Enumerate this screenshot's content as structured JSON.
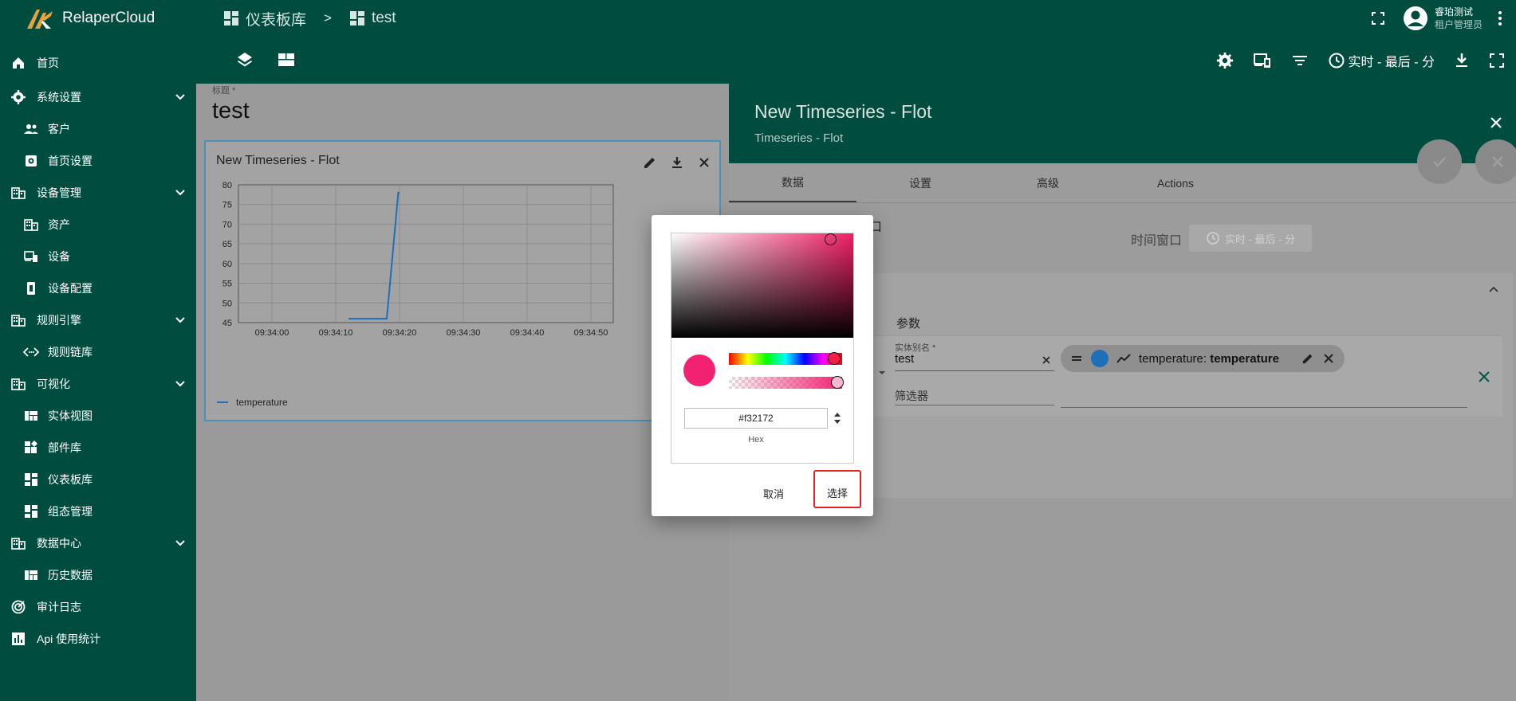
{
  "app": {
    "name": "RelaperCloud"
  },
  "sidebar": {
    "items": [
      {
        "label": "首页",
        "icon": "home-icon"
      },
      {
        "label": "系统设置",
        "icon": "gear-icon",
        "expandable": true
      },
      {
        "label": "客户",
        "icon": "people-icon",
        "sub": true
      },
      {
        "label": "首页设置",
        "icon": "settings-box-icon",
        "sub": true
      },
      {
        "label": "设备管理",
        "icon": "building-icon",
        "expandable": true
      },
      {
        "label": "资产",
        "icon": "building-icon",
        "sub": true
      },
      {
        "label": "设备",
        "icon": "devices-icon",
        "sub": true
      },
      {
        "label": "设备配置",
        "icon": "device-profile-icon",
        "sub": true
      },
      {
        "label": "规则引擎",
        "icon": "building-icon",
        "expandable": true
      },
      {
        "label": "规则链库",
        "icon": "code-icon",
        "sub": true
      },
      {
        "label": "可视化",
        "icon": "building-icon",
        "expandable": true
      },
      {
        "label": "实体视图",
        "icon": "view-quilt-icon",
        "sub": true
      },
      {
        "label": "部件库",
        "icon": "widgets-icon",
        "sub": true
      },
      {
        "label": "仪表板库",
        "icon": "dashboard-icon",
        "sub": true
      },
      {
        "label": "组态管理",
        "icon": "dashboard-icon",
        "sub": true
      },
      {
        "label": "数据中心",
        "icon": "building-icon",
        "expandable": true
      },
      {
        "label": "历史数据",
        "icon": "view-quilt-icon",
        "sub": true
      },
      {
        "label": "审计日志",
        "icon": "track-changes-icon"
      },
      {
        "label": "Api 使用统计",
        "icon": "insert-chart-icon"
      }
    ]
  },
  "header": {
    "breadcrumb": [
      {
        "label": "仪表板库"
      },
      {
        "label": "test"
      }
    ],
    "separator": ">",
    "user_name": "睿珀测试",
    "user_role": "租户管理员"
  },
  "toolbar": {
    "time_label": "实时 - 最后 - 分"
  },
  "dashboard": {
    "title_label": "标题 *",
    "title": "test",
    "widget": {
      "title": "New Timeseries - Flot",
      "legend_label": "temperature"
    }
  },
  "chart_data": {
    "type": "line",
    "series": [
      {
        "name": "temperature",
        "points": [
          [
            "09:34:12",
            46
          ],
          [
            "09:34:18",
            46
          ],
          [
            "09:34:19.8",
            78
          ],
          [
            "09:34:20",
            78
          ]
        ]
      }
    ],
    "xticks": [
      "09:34:00",
      "09:34:10",
      "09:34:20",
      "09:34:30",
      "09:34:40",
      "09:34:50"
    ],
    "yticks": [
      45,
      50,
      55,
      60,
      65,
      70,
      75,
      80
    ],
    "ylim": [
      45,
      80
    ],
    "grid": true,
    "legend": "bottom-left"
  },
  "panel": {
    "title": "New Timeseries - Flot",
    "subtitle": "Timeseries - Flot",
    "tabs": [
      {
        "label": "数据",
        "active": true
      },
      {
        "label": "设置"
      },
      {
        "label": "高级"
      },
      {
        "label": "Actions"
      }
    ],
    "time_window_suffix": "口",
    "time_window_label": "时间窗口",
    "time_window_value": "实时 - 最后 - 分",
    "params_label": "参数",
    "entity_alias_label": "实体别名 *",
    "entity_alias_value": "test",
    "filter_label": "筛选器",
    "key_chip": {
      "label_prefix": "temperature: ",
      "label_bold": "temperature"
    }
  },
  "color_picker": {
    "hex_value": "#f32172",
    "hex_label": "Hex",
    "cancel_label": "取消",
    "select_label": "选择",
    "selected_color": "#f32172"
  },
  "colors": {
    "primary": "#004d40",
    "series": "#1e6fb8",
    "highlight": "#e32222"
  }
}
